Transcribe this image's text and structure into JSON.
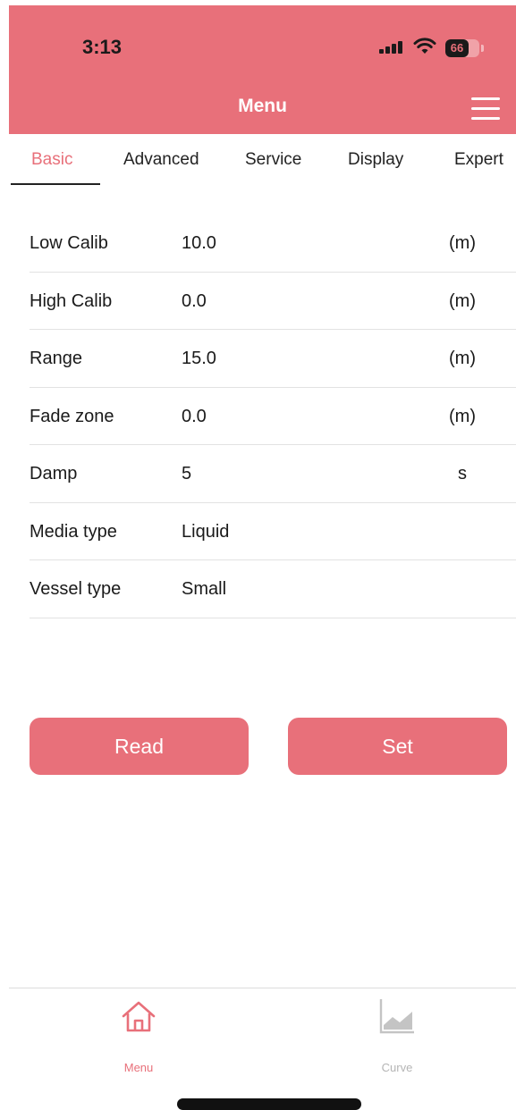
{
  "status_bar": {
    "time": "3:13",
    "battery": "66"
  },
  "header": {
    "title": "Menu",
    "menu_icon": "hamburger-icon",
    "background": "#e8707a"
  },
  "tabs": [
    {
      "label": "Basic",
      "active": true
    },
    {
      "label": "Advanced",
      "active": false
    },
    {
      "label": "Service",
      "active": false
    },
    {
      "label": "Display",
      "active": false
    },
    {
      "label": "Expert",
      "active": false
    }
  ],
  "form": {
    "rows": [
      {
        "label": "Low Calib",
        "value": "10.0",
        "unit": "(m)"
      },
      {
        "label": "High Calib",
        "value": "0.0",
        "unit": "(m)"
      },
      {
        "label": "Range",
        "value": "15.0",
        "unit": "(m)"
      },
      {
        "label": "Fade zone",
        "value": "0.0",
        "unit": "(m)"
      },
      {
        "label": "Damp",
        "value": "5",
        "unit": "s"
      },
      {
        "label": "Media type",
        "value": "Liquid",
        "unit": ""
      },
      {
        "label": "Vessel type",
        "value": "Small",
        "unit": ""
      }
    ]
  },
  "actions": {
    "read_label": "Read",
    "set_label": "Set"
  },
  "bottom_nav": [
    {
      "label": "Menu",
      "icon": "home-icon",
      "active": true
    },
    {
      "label": "Curve",
      "icon": "area-chart-icon",
      "active": false
    }
  ],
  "colors": {
    "accent": "#e8707a",
    "inactive": "#b5b5b5"
  }
}
